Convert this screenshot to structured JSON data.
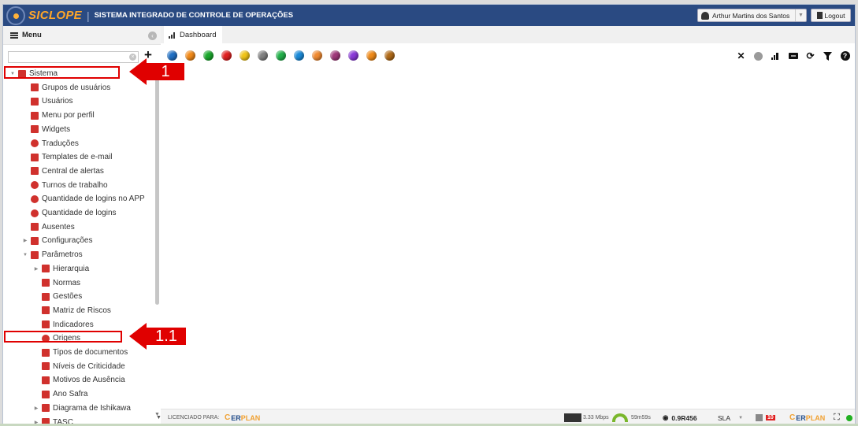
{
  "header": {
    "logo_text": "SICLOPE",
    "subtitle": "SISTEMA INTEGRADO DE CONTROLE DE OPERAÇÕES",
    "user_name": "Arthur Martins dos Santos",
    "logout_label": "Logout"
  },
  "sidebar": {
    "menu_label": "Menu",
    "search_placeholder": "",
    "tree": [
      {
        "label": "Sistema",
        "level": 0,
        "expanded": true,
        "icon": "folder-open-icon",
        "icon_color": "#d0312d"
      },
      {
        "label": "Grupos de usuários",
        "level": 1,
        "icon": "user-group-icon",
        "icon_color": "#d0312d"
      },
      {
        "label": "Usuários",
        "level": 1,
        "icon": "users-icon",
        "icon_color": "#d0312d"
      },
      {
        "label": "Menu por perfil",
        "level": 1,
        "icon": "sitemap-icon",
        "icon_color": "#d0312d"
      },
      {
        "label": "Widgets",
        "level": 1,
        "icon": "signal-icon",
        "icon_color": "#d0312d"
      },
      {
        "label": "Traduções",
        "level": 1,
        "icon": "globe-icon",
        "icon_color": "#d0312d"
      },
      {
        "label": "Templates de e-mail",
        "level": 1,
        "icon": "email-template-icon",
        "icon_color": "#d0312d"
      },
      {
        "label": "Central de alertas",
        "level": 1,
        "icon": "envelope-icon",
        "icon_color": "#d0312d"
      },
      {
        "label": "Turnos de trabalho",
        "level": 1,
        "icon": "stopwatch-icon",
        "icon_color": "#d0312d"
      },
      {
        "label": "Quantidade de logins no APP",
        "level": 1,
        "icon": "alert-circle-icon",
        "icon_color": "#d0312d"
      },
      {
        "label": "Quantidade de logins",
        "level": 1,
        "icon": "alert-circle-icon",
        "icon_color": "#d0312d"
      },
      {
        "label": "Ausentes",
        "level": 1,
        "icon": "calendar-x-icon",
        "icon_color": "#d0312d"
      },
      {
        "label": "Configurações",
        "level": 1,
        "collapsed": true,
        "icon": "sliders-icon",
        "icon_color": "#d0312d"
      },
      {
        "label": "Parâmetros",
        "level": 1,
        "expanded": true,
        "icon": "folder-open-icon",
        "icon_color": "#d0312d"
      },
      {
        "label": "Hierarquia",
        "level": 2,
        "collapsed": true,
        "icon": "gear-icon",
        "icon_color": "#d0312d"
      },
      {
        "label": "Normas",
        "level": 2,
        "icon": "book-icon",
        "icon_color": "#d0312d"
      },
      {
        "label": "Gestões",
        "level": 2,
        "icon": "team-icon",
        "icon_color": "#d0312d"
      },
      {
        "label": "Matriz de Riscos",
        "level": 2,
        "icon": "grid-icon",
        "icon_color": "#d0312d"
      },
      {
        "label": "Indicadores",
        "level": 2,
        "icon": "signal-icon",
        "icon_color": "#d0312d"
      },
      {
        "label": "Origens",
        "level": 2,
        "icon": "map-pin-icon",
        "icon_color": "#d0312d"
      },
      {
        "label": "Tipos de documentos",
        "level": 2,
        "icon": "document-grid-icon",
        "icon_color": "#d0312d"
      },
      {
        "label": "Níveis de Criticidade",
        "level": 2,
        "icon": "warning-icon",
        "icon_color": "#d0312d"
      },
      {
        "label": "Motivos de Ausência",
        "level": 2,
        "icon": "calendar-x-icon",
        "icon_color": "#d0312d"
      },
      {
        "label": "Ano Safra",
        "level": 2,
        "icon": "edit-document-icon",
        "icon_color": "#d0312d"
      },
      {
        "label": "Diagrama de Ishikawa",
        "level": 2,
        "collapsed": true,
        "icon": "fishbone-icon",
        "icon_color": "#d0312d"
      },
      {
        "label": "TASC",
        "level": 2,
        "collapsed": true,
        "icon": "tasc-icon",
        "icon_color": "#d0312d"
      }
    ]
  },
  "main": {
    "tab_label": "Dashboard",
    "color_dots": [
      "#1f6fc4",
      "#f28a18",
      "#1aa82c",
      "#e02020",
      "#f0c418",
      "#808080",
      "#22b04a",
      "#1a8ad8",
      "#f08a30",
      "#a0387a",
      "#8a3ad8",
      "#f08a18",
      "#b06a18"
    ],
    "tool_icons": [
      "close-icon",
      "circle-gray-icon",
      "signal-icon",
      "transfer-icon",
      "refresh-icon",
      "filter-icon",
      "help-icon"
    ]
  },
  "footer": {
    "licensed_label": "LICENCIADO PARA:",
    "erplan_c": "C",
    "erplan_er": "ER",
    "erplan_plan": "PLAN",
    "speed": "3.33 Mbps",
    "uptime": "59m59s",
    "version": "0.9R456",
    "sla_label": "SLA",
    "badge_count": "10"
  },
  "annotations": {
    "step1": "1",
    "step1_1": "1.1"
  }
}
